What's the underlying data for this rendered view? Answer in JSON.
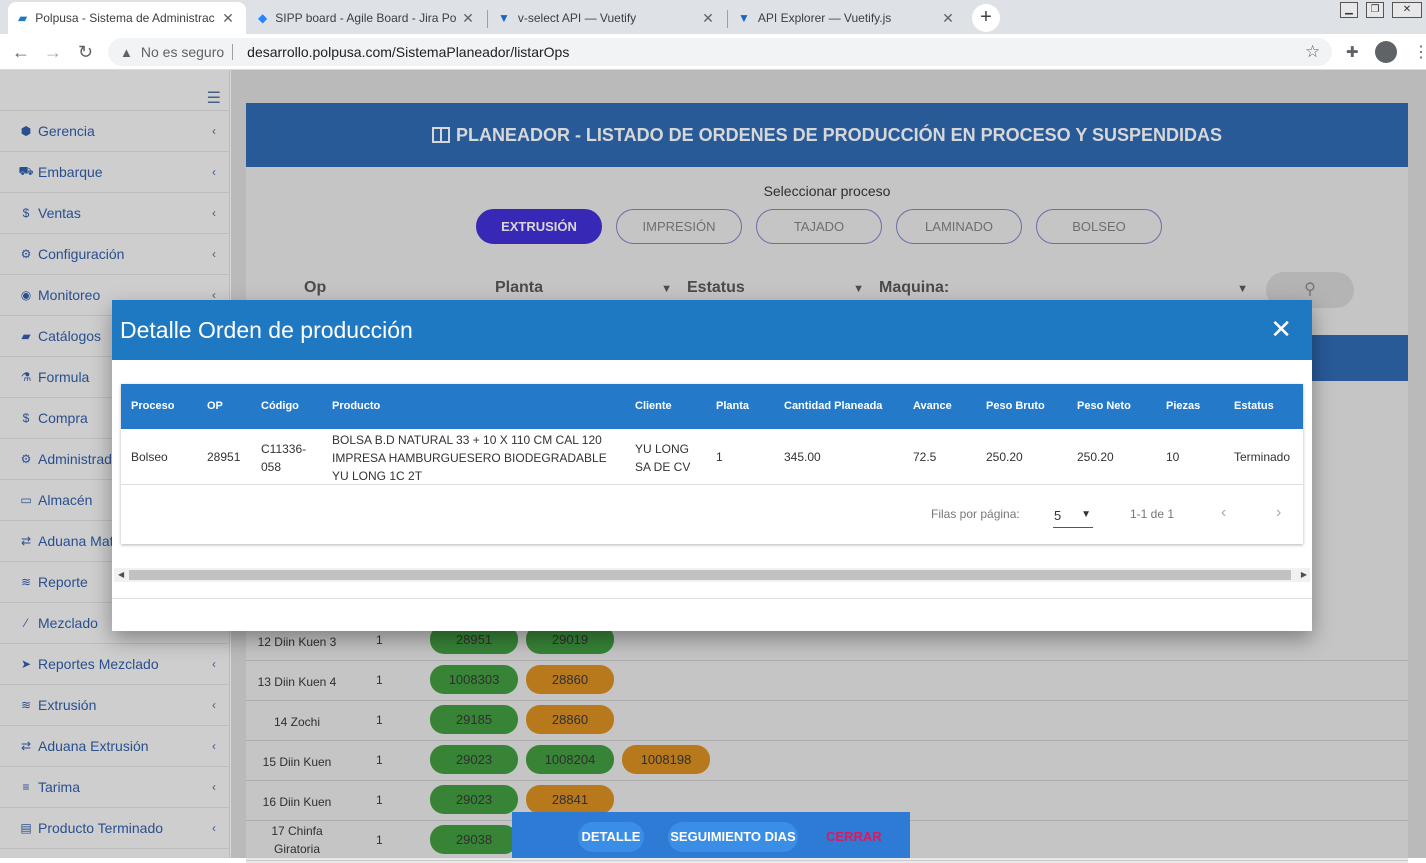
{
  "browser": {
    "tabs": [
      {
        "title": "Polpusa - Sistema de Administrac",
        "active": true
      },
      {
        "title": "SIPP board - Agile Board - Jira Po",
        "active": false
      },
      {
        "title": "v-select API — Vuetify",
        "active": false
      },
      {
        "title": "API Explorer — Vuetify.js",
        "active": false
      }
    ],
    "security_label": "No es seguro",
    "url": "desarrollo.polpusa.com/SistemaPlaneador/listarOps"
  },
  "sidebar": {
    "items": [
      {
        "label": "Gerencia",
        "icon": "cube-icon",
        "glyph": "⬢",
        "has_children": true
      },
      {
        "label": "Embarque",
        "icon": "truck-icon",
        "glyph": "⛟",
        "has_children": true
      },
      {
        "label": "Ventas",
        "icon": "dollar-icon",
        "glyph": "$",
        "has_children": true
      },
      {
        "label": "Configuración",
        "icon": "gear-icon",
        "glyph": "⚙",
        "has_children": true
      },
      {
        "label": "Monitoreo",
        "icon": "eye-icon",
        "glyph": "◉",
        "has_children": true
      },
      {
        "label": "Catálogos",
        "icon": "folder-icon",
        "glyph": "▰",
        "has_children": false
      },
      {
        "label": "Formula",
        "icon": "flask-icon",
        "glyph": "⚗",
        "has_children": false
      },
      {
        "label": "Compra",
        "icon": "dollar-icon",
        "glyph": "$",
        "has_children": false
      },
      {
        "label": "Administrado",
        "icon": "gear-icon",
        "glyph": "⚙",
        "has_children": false
      },
      {
        "label": "Almacén",
        "icon": "laptop-icon",
        "glyph": "▭",
        "has_children": false
      },
      {
        "label": "Aduana Mat",
        "icon": "exchange-icon",
        "glyph": "⇄",
        "has_children": false
      },
      {
        "label": "Reporte",
        "icon": "database-icon",
        "glyph": "≋",
        "has_children": false
      },
      {
        "label": "Mezclado",
        "icon": "magic-icon",
        "glyph": "⁄",
        "has_children": false
      },
      {
        "label": "Reportes Mezclado",
        "icon": "location-arrow-icon",
        "glyph": "➤",
        "has_children": true
      },
      {
        "label": "Extrusión",
        "icon": "database-icon",
        "glyph": "≋",
        "has_children": true
      },
      {
        "label": "Aduana Extrusión",
        "icon": "exchange-icon",
        "glyph": "⇄",
        "has_children": true
      },
      {
        "label": "Tarima",
        "icon": "bars-icon",
        "glyph": "≡",
        "has_children": true
      },
      {
        "label": "Producto Terminado",
        "icon": "hdd-icon",
        "glyph": "▤",
        "has_children": true
      }
    ]
  },
  "page": {
    "title": "PLANEADOR - LISTADO DE ORDENES DE PRODUCCIÓN EN PROCESO Y SUSPENDIDAS",
    "select_process_label": "Seleccionar proceso",
    "process_buttons": [
      {
        "label": "EXTRUSIÓN",
        "active": true
      },
      {
        "label": "IMPRESIÓN",
        "active": false
      },
      {
        "label": "TAJADO",
        "active": false
      },
      {
        "label": "LAMINADO",
        "active": false
      },
      {
        "label": "BOLSEO",
        "active": false
      }
    ],
    "filters": {
      "op": "Op",
      "planta": "Planta",
      "estatus": "Estatus",
      "maquina": "Maquina:"
    }
  },
  "machine_rows": [
    {
      "name": "12 Diin Kuen 3",
      "planta": "1",
      "chips": [
        {
          "label": "28951",
          "color": "green"
        },
        {
          "label": "29019",
          "color": "green"
        }
      ]
    },
    {
      "name": "13 Diin Kuen 4",
      "planta": "1",
      "chips": [
        {
          "label": "1008303",
          "color": "green"
        },
        {
          "label": "28860",
          "color": "orange"
        }
      ]
    },
    {
      "name": "14 Zochi",
      "planta": "1",
      "chips": [
        {
          "label": "29185",
          "color": "green"
        },
        {
          "label": "28860",
          "color": "orange"
        }
      ]
    },
    {
      "name": "15 Diin Kuen",
      "planta": "1",
      "chips": [
        {
          "label": "29023",
          "color": "green"
        },
        {
          "label": "1008204",
          "color": "green"
        },
        {
          "label": "1008198",
          "color": "orange"
        }
      ]
    },
    {
      "name": "16 Diin Kuen",
      "planta": "1",
      "chips": [
        {
          "label": "29023",
          "color": "green"
        },
        {
          "label": "28841",
          "color": "orange"
        }
      ]
    },
    {
      "name": "17 Chinfa Giratoria",
      "planta": "1",
      "chips": [
        {
          "label": "29038",
          "color": "green"
        }
      ]
    }
  ],
  "dialog": {
    "title": "Detalle Orden de producción",
    "columns": [
      "Proceso",
      "OP",
      "Código",
      "Producto",
      "Cliente",
      "Planta",
      "Cantidad Planeada",
      "Avance",
      "Peso Bruto",
      "Peso Neto",
      "Piezas",
      "Estatus"
    ],
    "row": {
      "proceso": "Bolseo",
      "op": "28951",
      "codigo": "C11336-058",
      "producto": "BOLSA B.D NATURAL 33 + 10 X 110 CM CAL 120 IMPRESA HAMBURGUESERO BIODEGRADABLE YU LONG 1C 2T",
      "cliente": "YU LONG SA DE CV",
      "planta": "1",
      "cantidad_planeada": "345.00",
      "avance": "72.5",
      "peso_bruto": "250.20",
      "peso_neto": "250.20",
      "piezas": "10",
      "estatus": "Terminado"
    },
    "footer": {
      "rows_per_page_label": "Filas por página:",
      "rows_per_page": "5",
      "range": "1-1 de 1"
    }
  },
  "bottom_actions": {
    "detalle": "DETALLE",
    "seguimiento": "SEGUIMIENTO DIAS",
    "cerrar": "CERRAR"
  }
}
